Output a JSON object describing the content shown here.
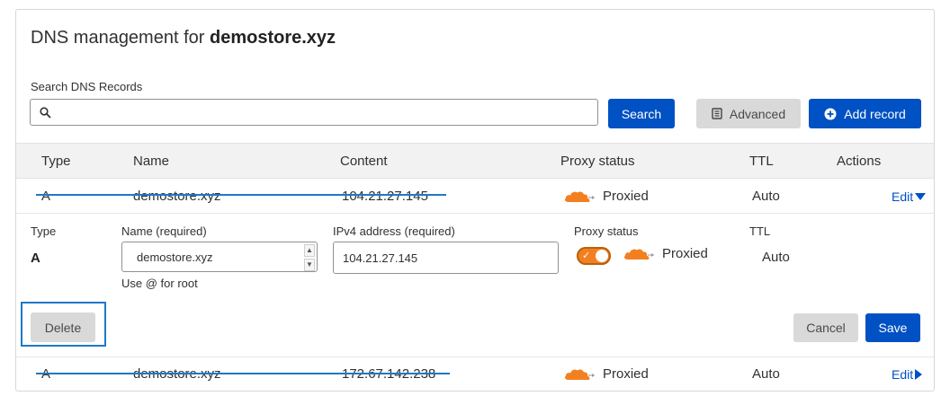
{
  "header": {
    "title_prefix": "DNS management for",
    "domain": "demostore.xyz"
  },
  "search": {
    "label": "Search DNS Records",
    "value": "",
    "placeholder": "",
    "button": "Search"
  },
  "toolbar": {
    "advanced_label": "Advanced",
    "add_record_label": "Add record"
  },
  "table": {
    "columns": [
      "Type",
      "Name",
      "Content",
      "Proxy status",
      "TTL",
      "Actions"
    ],
    "rows": [
      {
        "type": "A",
        "name": "demostore.xyz",
        "content": "104.21.27.145",
        "proxy": "Proxied",
        "ttl": "Auto",
        "action": "Edit",
        "struck": true,
        "expanded": true
      },
      {
        "type": "A",
        "name": "demostore.xyz",
        "content": "172.67.142.238",
        "proxy": "Proxied",
        "ttl": "Auto",
        "action": "Edit",
        "struck": true,
        "expanded": false
      }
    ]
  },
  "editor": {
    "type_label": "Type",
    "type_value": "A",
    "name_label": "Name (required)",
    "name_value": "demostore.xyz",
    "name_hint": "Use @ for root",
    "content_label": "IPv4 address (required)",
    "content_value": "104.21.27.145",
    "proxy_label": "Proxy status",
    "proxy_value": "Proxied",
    "proxy_enabled": true,
    "ttl_label": "TTL",
    "ttl_value": "Auto",
    "delete_label": "Delete",
    "cancel_label": "Cancel",
    "save_label": "Save"
  },
  "colors": {
    "primary": "#0051c3",
    "proxy_orange": "#f38020",
    "annotation_blue": "#1f78c8"
  }
}
